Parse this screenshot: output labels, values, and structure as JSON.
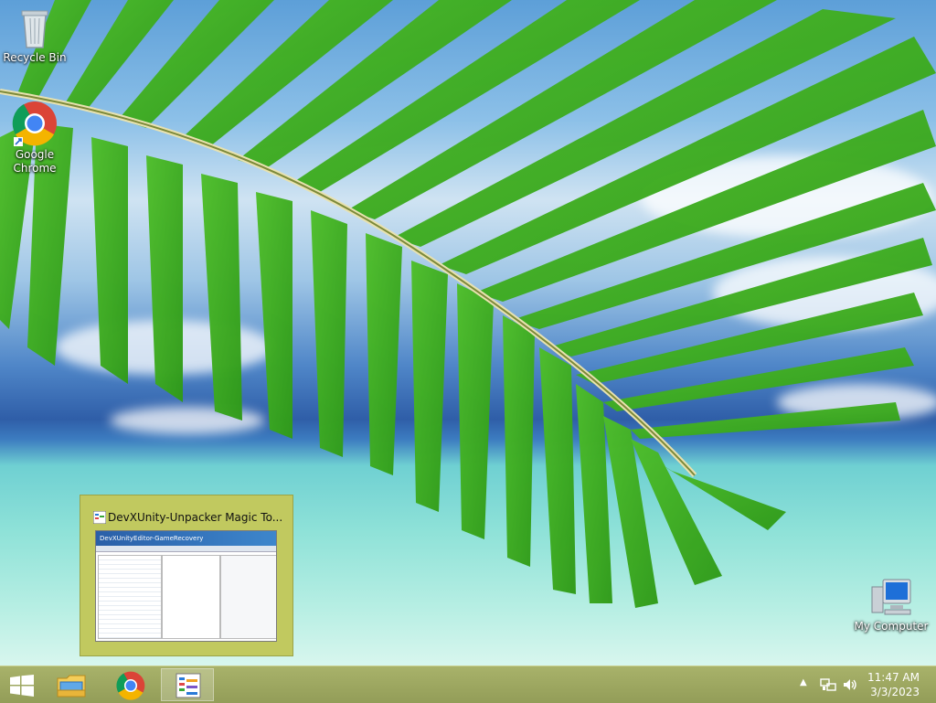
{
  "desktop": {
    "icons": [
      {
        "label": "Recycle Bin"
      },
      {
        "label": "Google Chrome"
      },
      {
        "label": "My Computer"
      }
    ]
  },
  "thumbnail": {
    "title": "DevXUnity-Unpacker Magic To...",
    "banner_text": "DevXUnityEditor-GameRecovery"
  },
  "taskbar": {
    "buttons": [
      "start",
      "file-explorer",
      "google-chrome",
      "devxunity-unpacker"
    ],
    "tray": {
      "icons": [
        "show-hidden-icons-chevron",
        "network-icon",
        "volume-icon"
      ]
    }
  },
  "clock": {
    "time": "11:47 AM",
    "date": "3/3/2023"
  }
}
